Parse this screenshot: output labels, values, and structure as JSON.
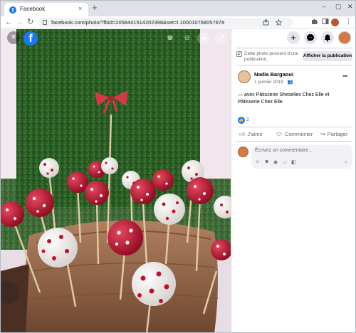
{
  "browser": {
    "tab_title": "Facebook",
    "tab_favicon": "f",
    "tab_close": "×",
    "new_tab": "+",
    "url": "facebook.com/photo/?fbid=2058441514202398&set=t.100010768057678",
    "win_min": "–",
    "win_max": "▢",
    "win_close": "✕",
    "back": "←",
    "forward": "→",
    "reload": "↻"
  },
  "viewer": {
    "close_icon": "✕",
    "fb_logo": "f",
    "zoom_in": "⊕",
    "zoom_out": "⊖",
    "tag": "◆",
    "fullscreen": "⤢"
  },
  "panel": {
    "plus": "+",
    "notice": "Cette photo provient d'une publication.",
    "show_publication": "Afficher la publication",
    "author": "Nadia Bargaoui",
    "date": "1 janvier 2019 · 👥",
    "more": "•••",
    "caption": "— avec Pâtisserie Sheselles Chez Elle et Pâtisserie Chez Elle.",
    "like_count": "2",
    "actions": {
      "like": "J'aime",
      "comment": "Commenter",
      "share": "Partager"
    },
    "comment_placeholder": "Écrivez un commentaire..."
  },
  "colors": {
    "facebook_blue": "#1877f2",
    "cake_pop_red": "#c2102e"
  },
  "icons": [
    "search-icon",
    "star-icon",
    "puzzle-icon",
    "messenger-icon",
    "bell-icon",
    "like-icon",
    "comment-icon",
    "share-icon"
  ]
}
